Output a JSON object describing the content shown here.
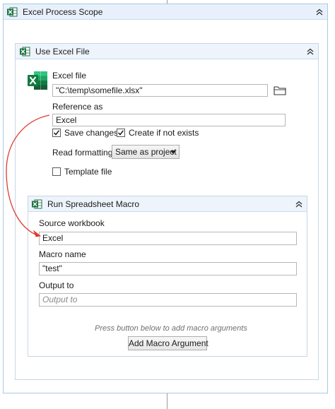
{
  "outer_scope": {
    "title": "Excel Process Scope",
    "collapse_icon": "double-chevron-up-icon"
  },
  "use_excel_file": {
    "title": "Use Excel File",
    "excel_file_label": "Excel file",
    "excel_file_value": "\"C:\\temp\\somefile.xlsx\"",
    "folder_icon": "folder-icon",
    "reference_as_label": "Reference as",
    "reference_as_value": "Excel",
    "save_changes_label": "Save changes",
    "save_changes_checked": true,
    "create_if_not_exists_label": "Create if not exists",
    "create_if_not_exists_checked": true,
    "read_formatting_label": "Read formatting",
    "read_formatting_value": "Same as project",
    "template_file_label": "Template file",
    "template_file_checked": false
  },
  "run_spreadsheet_macro": {
    "title": "Run Spreadsheet Macro",
    "source_workbook_label": "Source workbook",
    "source_workbook_value": "Excel",
    "macro_name_label": "Macro name",
    "macro_name_value": "\"test\"",
    "output_to_label": "Output to",
    "output_to_placeholder": "Output to",
    "hint_text": "Press button below to add macro arguments",
    "add_argument_label": "Add Macro Argument"
  },
  "colors": {
    "excel_green": "#1e7145",
    "annotation_red": "#e03c31",
    "header_blue": "#e8f1fb"
  }
}
